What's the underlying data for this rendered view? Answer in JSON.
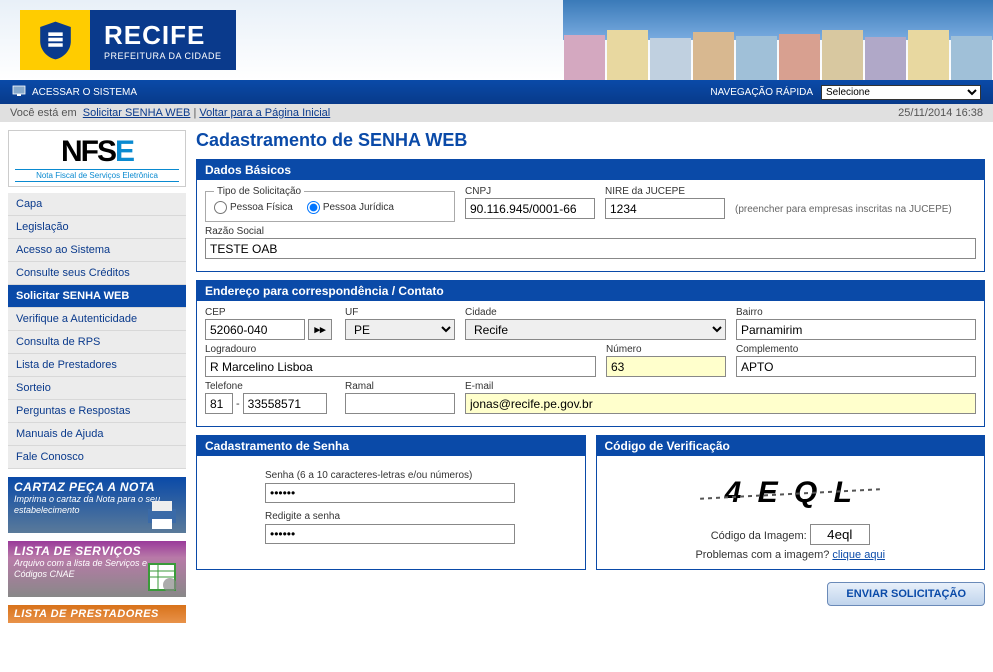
{
  "header": {
    "city": "RECIFE",
    "city_sub": "PREFEITURA DA CIDADE"
  },
  "topbar": {
    "access_label": "ACESSAR O SISTEMA",
    "nav_label": "NAVEGAÇÃO RÁPIDA",
    "nav_selected": "Selecione"
  },
  "breadcrumb": {
    "prefix": "Você está em",
    "link1": "Solicitar SENHA WEB",
    "sep": " | ",
    "link2": "Voltar para a Página Inicial",
    "timestamp": "25/11/2014 16:38"
  },
  "page_title": "Cadastramento de SENHA WEB",
  "nfse": {
    "tag": "Nota Fiscal de Serviços Eletrônica"
  },
  "menu": {
    "items": [
      "Capa",
      "Legislação",
      "Acesso ao Sistema",
      "Consulte seus Créditos",
      "Solicitar SENHA WEB",
      "Verifique a Autenticidade",
      "Consulta de RPS",
      "Lista de Prestadores",
      "Sorteio",
      "Perguntas e Respostas",
      "Manuais de Ajuda",
      "Fale Conosco"
    ],
    "active_index": 4
  },
  "promos": {
    "p1_title": "CARTAZ PEÇA A NOTA",
    "p1_sub": "Imprima o cartaz da Nota para o seu estabelecimento",
    "p2_title": "LISTA DE SERVIÇOS",
    "p2_sub": "Arquivo com a lista de Serviços e Códigos CNAE",
    "p3_title": "LISTA DE PRESTADORES"
  },
  "panel_basic": {
    "title": "Dados Básicos",
    "tipo_label": "Tipo de Solicitação",
    "pf": "Pessoa Física",
    "pj": "Pessoa Jurídica",
    "cnpj_label": "CNPJ",
    "cnpj_value": "90.116.945/0001-66",
    "nire_label": "NIRE da JUCEPE",
    "nire_value": "1234",
    "nire_hint": "(preencher para empresas inscritas na JUCEPE)",
    "razao_label": "Razão Social",
    "razao_value": "TESTE OAB"
  },
  "panel_endereco": {
    "title": "Endereço para correspondência / Contato",
    "cep_label": "CEP",
    "cep_value": "52060-040",
    "uf_label": "UF",
    "uf_value": "PE",
    "cidade_label": "Cidade",
    "cidade_value": "Recife",
    "bairro_label": "Bairro",
    "bairro_value": "Parnamirim",
    "logradouro_label": "Logradouro",
    "logradouro_value": "R Marcelino Lisboa",
    "numero_label": "Número",
    "numero_value": "63",
    "complemento_label": "Complemento",
    "complemento_value": "APTO",
    "telefone_label": "Telefone",
    "telefone_ddd": "81",
    "telefone_num": "33558571",
    "ramal_label": "Ramal",
    "ramal_value": "",
    "email_label": "E-mail",
    "email_value": "jonas@recife.pe.gov.br"
  },
  "panel_senha": {
    "title": "Cadastramento de Senha",
    "senha_label": "Senha (6 a 10 caracteres-letras e/ou números)",
    "redigite_label": "Redigite a senha",
    "senha_value": "••••••",
    "redigite_value": "••••••"
  },
  "panel_captcha": {
    "title": "Código de Verificação",
    "image_text": "4 E Q L",
    "input_label": "Código da Imagem:",
    "input_value": "4eql",
    "problem_text": "Problemas com a imagem?",
    "problem_link": "clique aqui"
  },
  "submit_label": "ENVIAR SOLICITAÇÃO"
}
